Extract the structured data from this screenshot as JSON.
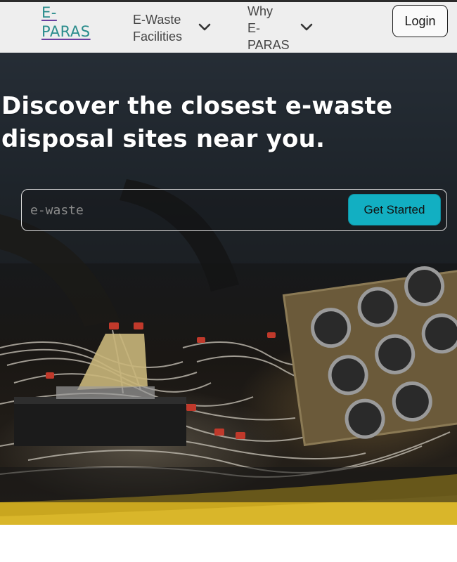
{
  "navbar": {
    "logo_line1": "E-",
    "logo_line2": "PARAS",
    "facilities_line1": "E-Waste",
    "facilities_line2": "Facilities",
    "why_line1": "Why",
    "why_line2": "E-",
    "why_line3": "PARAS",
    "login_label": "Login",
    "dropdown_icon": "chevron-down-icon"
  },
  "hero": {
    "headline_line1": "Discover the closest e-waste",
    "headline_line2": "disposal sites near you.",
    "search_placeholder": "e-waste",
    "cta_label": "Get Started",
    "background_image": "electronic-waste-photo"
  },
  "colors": {
    "logo": "#2a8c8c",
    "cta_background": "#12afc2",
    "navbar_background": "#eeeeee",
    "headline": "#ffffff"
  }
}
